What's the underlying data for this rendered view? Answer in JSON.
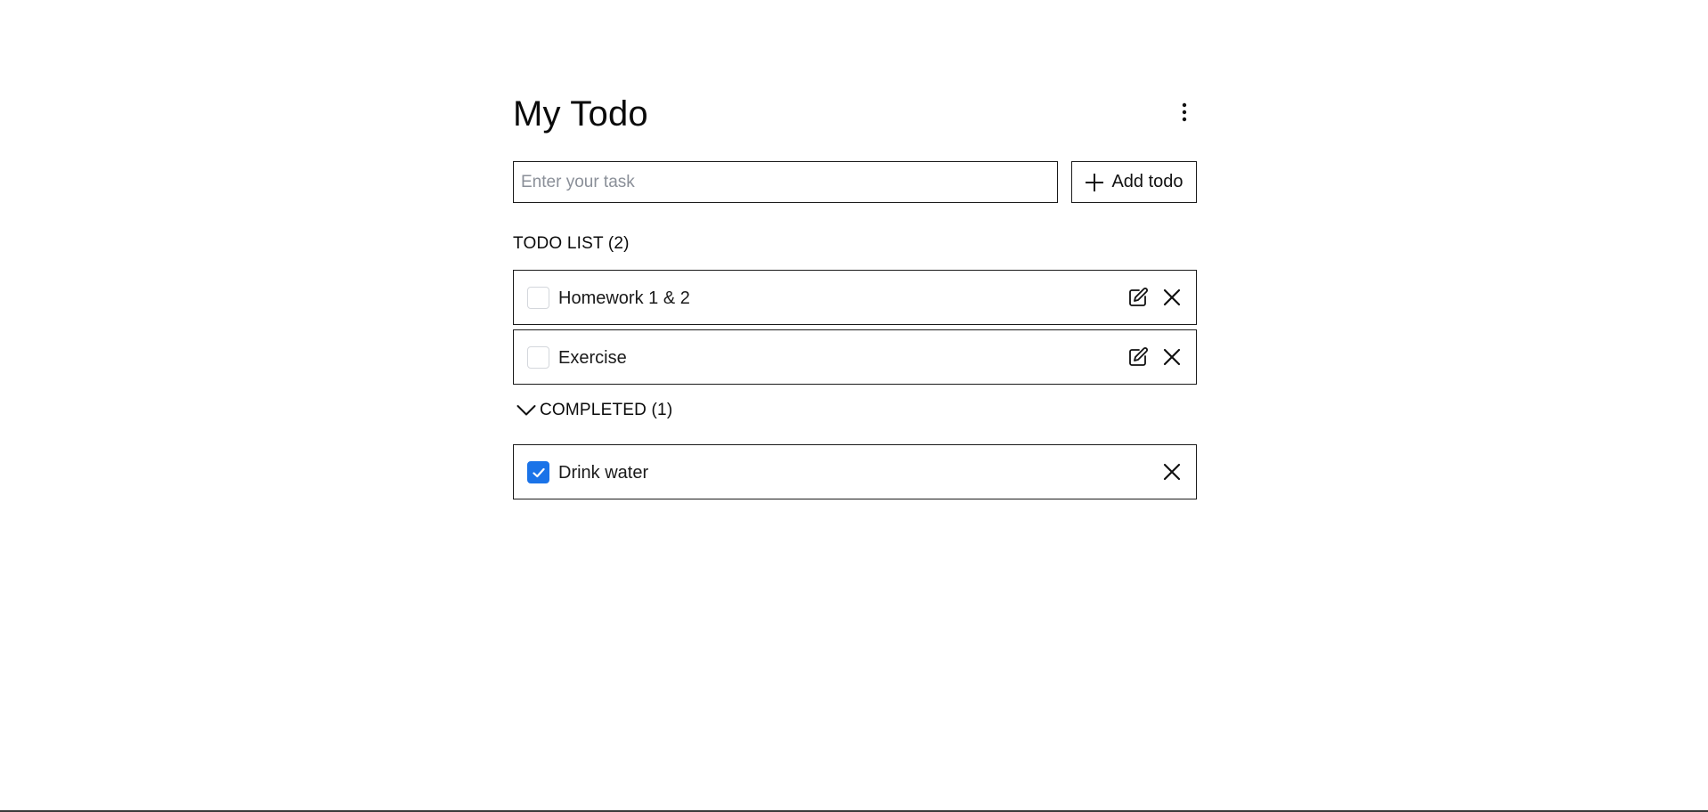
{
  "app": {
    "title": "My Todo"
  },
  "add_form": {
    "input_placeholder": "Enter your task",
    "input_value": "",
    "add_button_label": "Add todo"
  },
  "todo_list": {
    "heading": "TODO LIST (2)",
    "items": [
      {
        "label": "Homework 1 & 2",
        "checked": false
      },
      {
        "label": "Exercise",
        "checked": false
      }
    ]
  },
  "completed": {
    "heading": "COMPLETED (1)",
    "expanded": true,
    "items": [
      {
        "label": "Drink water",
        "checked": true
      }
    ]
  },
  "icons": {
    "menu": "kebab-menu-icon",
    "add": "plus-icon",
    "edit": "edit-icon",
    "delete": "close-icon",
    "collapse": "chevron-down-icon",
    "check": "check-icon"
  },
  "colors": {
    "accent": "#1a73e8",
    "border": "#1a1a1a",
    "text": "#111111",
    "placeholder": "#8a8f98"
  }
}
